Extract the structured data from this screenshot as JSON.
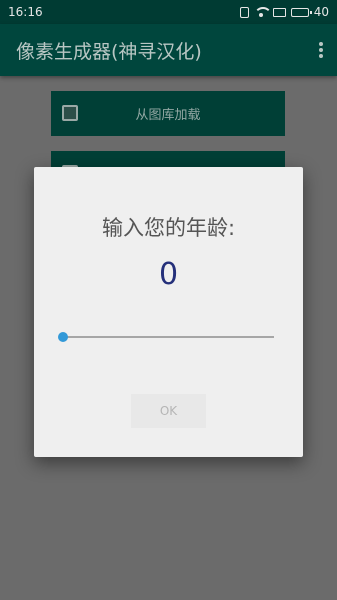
{
  "status_bar": {
    "time": "16:16",
    "battery_level": "40",
    "icons": [
      "vibrate-icon",
      "wifi-icon",
      "message-icon",
      "battery-icon"
    ]
  },
  "app_bar": {
    "title": "像素生成器(神寻汉化)",
    "menu_icon": "more-vert-icon"
  },
  "main": {
    "buttons": [
      {
        "label": "从图库加载",
        "icon": "image-icon"
      },
      {
        "label": "",
        "icon": "image-icon"
      }
    ]
  },
  "dialog": {
    "title": "输入您的年龄:",
    "value": "0",
    "slider_value": 0,
    "ok_label": "OK"
  },
  "colors": {
    "status_bar": "#003b33",
    "app_bar": "#00463d",
    "overlay": "#6b6b6b",
    "accent": "#3299d8",
    "value_text": "#25307a"
  }
}
